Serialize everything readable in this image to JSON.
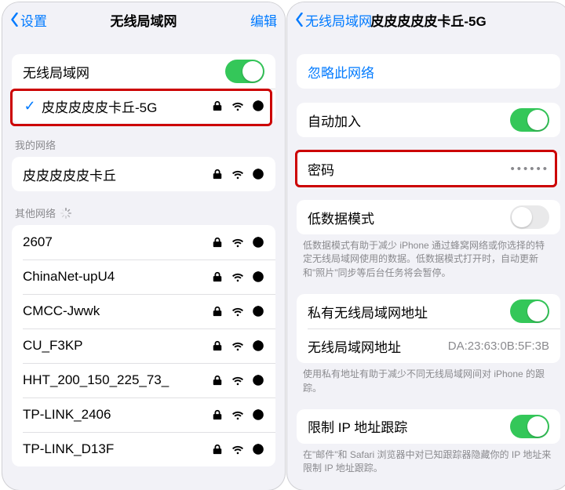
{
  "left": {
    "nav": {
      "back": "设置",
      "title": "无线局域网",
      "right": "编辑"
    },
    "wifi_toggle_label": "无线局域网",
    "wifi_toggle_on": true,
    "connected": {
      "name": "皮皮皮皮皮卡丘-5G",
      "locked": true
    },
    "my_header": "我的网络",
    "my": [
      {
        "name": "皮皮皮皮皮卡丘",
        "locked": true
      }
    ],
    "other_header": "其他网络",
    "other": [
      {
        "name": "2607",
        "locked": true
      },
      {
        "name": "ChinaNet-upU4",
        "locked": true
      },
      {
        "name": "CMCC-Jwwk",
        "locked": true
      },
      {
        "name": "CU_F3KP",
        "locked": true
      },
      {
        "name": "HHT_200_150_225_73_",
        "locked": true
      },
      {
        "name": "TP-LINK_2406",
        "locked": true
      },
      {
        "name": "TP-LINK_D13F",
        "locked": true
      }
    ]
  },
  "right": {
    "nav": {
      "back": "无线局域网",
      "title": "皮皮皮皮皮卡丘-5G"
    },
    "forget": "忽略此网络",
    "auto_join": {
      "label": "自动加入",
      "on": true
    },
    "password": {
      "label": "密码",
      "value": "••••••"
    },
    "low_data": {
      "label": "低数据模式",
      "on": false,
      "footer": "低数据模式有助于减少 iPhone 通过蜂窝网络或你选择的特定无线局域网使用的数据。低数据模式打开时，自动更新和\"照片\"同步等后台任务将会暂停。"
    },
    "private_addr": {
      "label": "私有无线局域网地址",
      "on": true,
      "mac_label": "无线局域网地址",
      "mac": "DA:23:63:0B:5F:3B",
      "footer": "使用私有地址有助于减少不同无线局域网间对 iPhone 的跟踪。"
    },
    "limit_ip": {
      "label": "限制 IP 地址跟踪",
      "on": true,
      "footer": "在\"邮件\"和 Safari 浏览器中对已知跟踪器隐藏你的 IP 地址来限制 IP 地址跟踪。"
    }
  }
}
